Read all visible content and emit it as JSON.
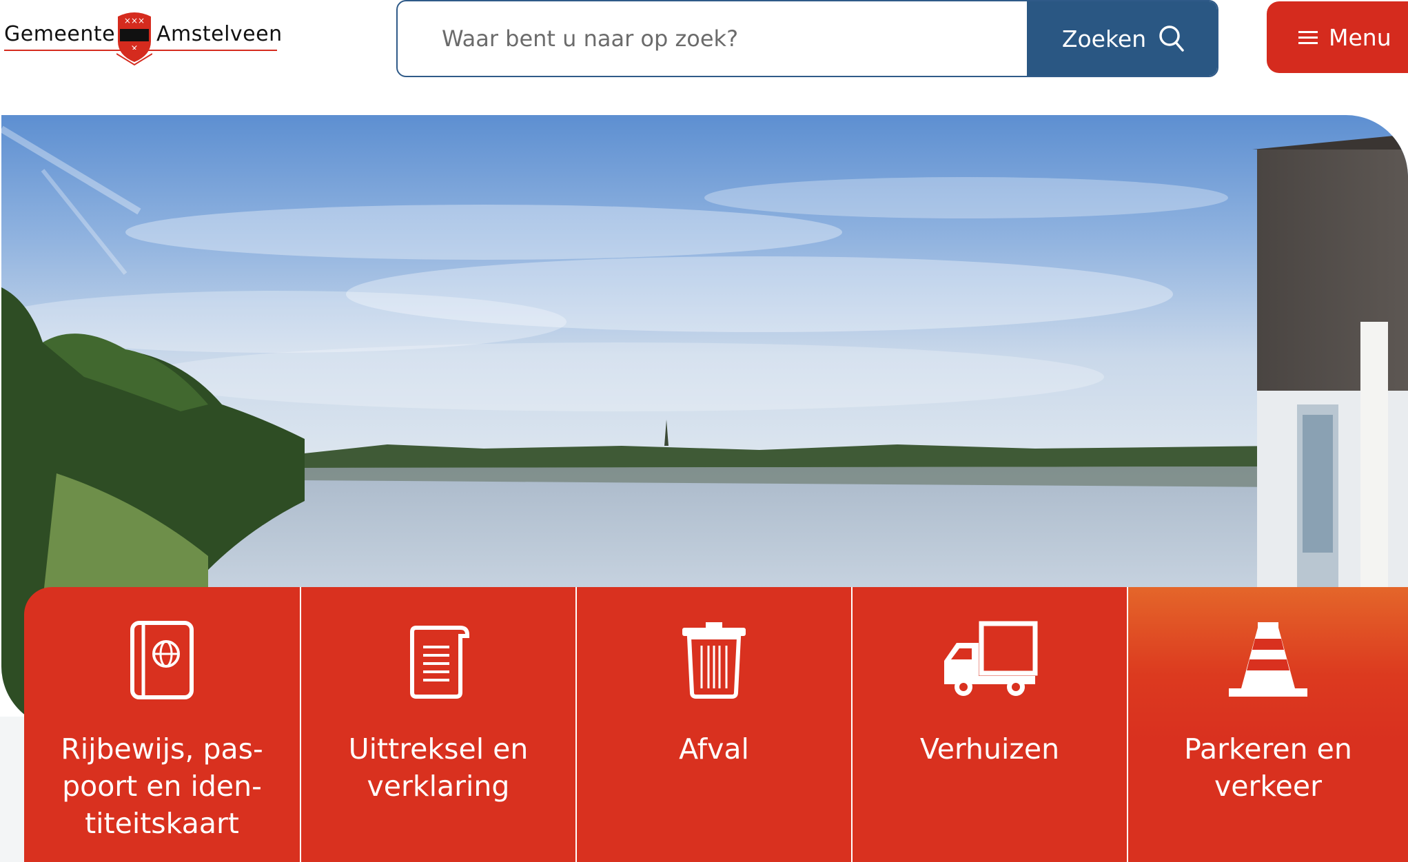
{
  "logo": {
    "name_left": "Gemeente",
    "name_right": "Amstelveen",
    "icon": "coat-of-arms-icon"
  },
  "search": {
    "placeholder": "Waar bent u naar op zoek?",
    "value": "",
    "button_label": "Zoeken",
    "button_icon": "search-icon"
  },
  "menu": {
    "label": "Menu",
    "icon": "hamburger-icon"
  },
  "hero": {
    "image": "lake-landscape-photo"
  },
  "tiles": [
    {
      "label": "Rijbewijs, pas-\npoort en iden-\ntiteitskaart",
      "icon": "passport-icon"
    },
    {
      "label": "Uittreksel en\nverklaring",
      "icon": "document-scroll-icon"
    },
    {
      "label": "Afval",
      "icon": "trash-bin-icon"
    },
    {
      "label": "Verhuizen",
      "icon": "moving-truck-icon"
    },
    {
      "label": "Parkeren en\nverkeer",
      "icon": "traffic-cone-icon"
    }
  ],
  "colors": {
    "brand_red": "#d52b1e",
    "search_blue": "#2a5783",
    "tile_red": "#d9311f"
  }
}
